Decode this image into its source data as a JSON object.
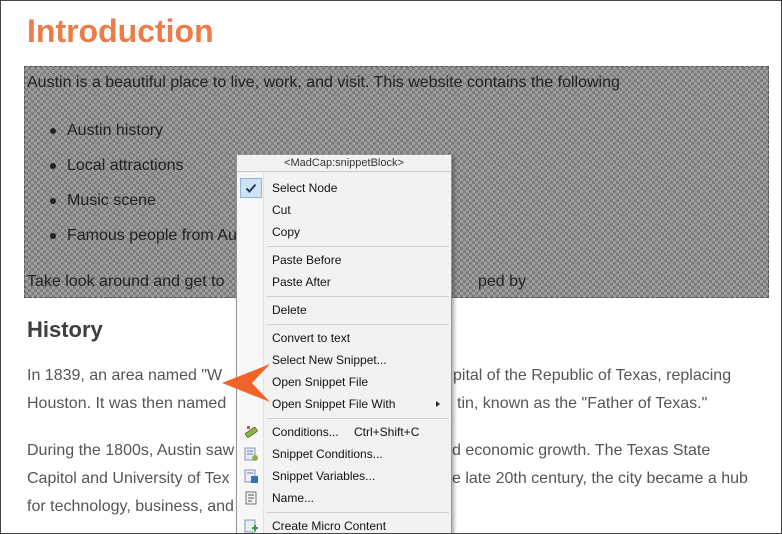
{
  "page": {
    "heading": "Introduction",
    "snippet": {
      "intro": "Austin is a beautiful place to live, work, and visit. This website contains the following",
      "list": [
        "Austin history",
        "Local attractions",
        "Music scene",
        "Famous people from Au"
      ],
      "footer_start": "Take look around and get to",
      "footer_end": "ped by"
    },
    "section_heading": "History",
    "para1": {
      "line1_start": "In 1839, an area named \"W",
      "line1_end": "pital of the Republic of Texas, replacing",
      "line2_start": "Houston. It was then named",
      "line2_end": "tin, known as the \"Father of Texas.\""
    },
    "para2": {
      "line1_start": "During the 1800s, Austin saw",
      "line1_end": "d economic growth. The Texas State",
      "line2_start": "Capitol and University of Tex",
      "line2_end": "e late 20th century, the city became a hub",
      "line3_start": "for technology, business, and"
    }
  },
  "context_menu": {
    "header": "<MadCap:snippetBlock>",
    "items": [
      {
        "label": "Select Node",
        "checked": true,
        "icon": "check-icon"
      },
      {
        "label": "Cut"
      },
      {
        "label": "Copy"
      },
      {
        "label": "Paste Before"
      },
      {
        "label": "Paste After"
      },
      {
        "label": "Delete"
      },
      {
        "label": "Convert to text"
      },
      {
        "label": "Select New Snippet..."
      },
      {
        "label": "Open Snippet File"
      },
      {
        "label": "Open Snippet File With",
        "submenu": true
      },
      {
        "label": "Conditions...",
        "shortcut": "Ctrl+Shift+C",
        "icon": "conditions-icon"
      },
      {
        "label": "Snippet Conditions...",
        "icon": "snippet-conditions-icon"
      },
      {
        "label": "Snippet Variables...",
        "icon": "snippet-variables-icon"
      },
      {
        "label": "Name...",
        "icon": "name-icon"
      },
      {
        "label": "Create Micro Content",
        "icon": "create-micro-content-icon"
      }
    ]
  },
  "colors": {
    "heading": "#ec7d4a",
    "pointer_arrow": "#f0642a",
    "check_highlight": "#cfe3f7"
  }
}
